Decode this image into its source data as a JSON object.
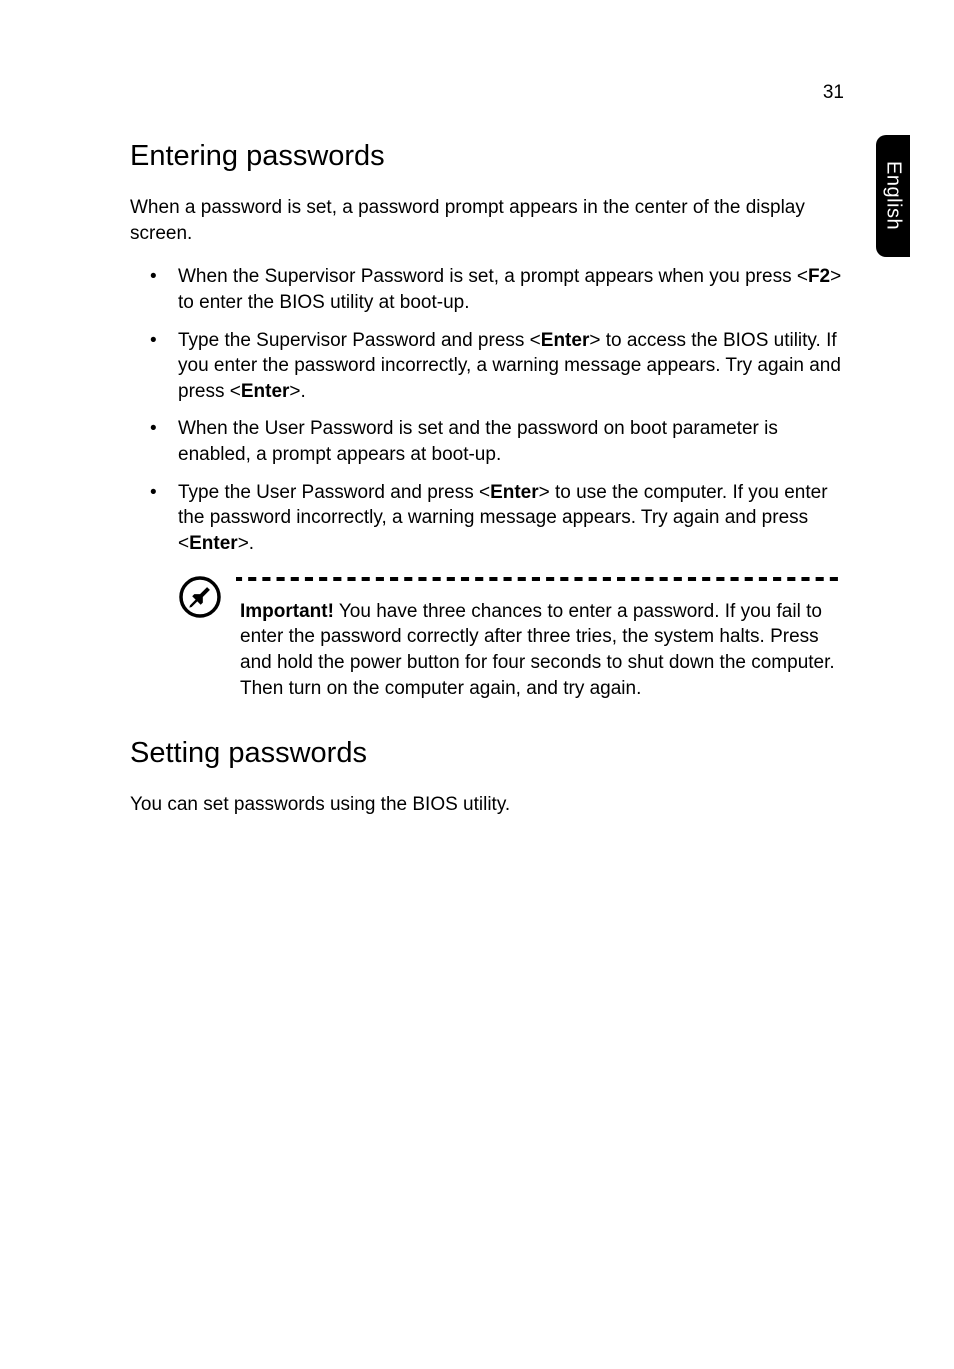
{
  "page_number": "31",
  "side_tab_label": "English",
  "section1": {
    "heading": "Entering passwords",
    "intro": "When a password is set, a password prompt appears in the center of the display screen.",
    "bullets": [
      {
        "pre": "When the Supervisor Password is set, a prompt appears when you press <",
        "key1": "F2",
        "post1": "> to enter the BIOS utility at boot-up."
      },
      {
        "pre": "Type the Supervisor Password and press <",
        "key1": "Enter",
        "mid1": "> to access the BIOS utility. If you enter the password incorrectly, a warning message appears. Try again and press <",
        "key2": "Enter",
        "post2": ">."
      },
      {
        "pre": "When the User Password is set and the password on boot parameter is enabled, a prompt appears at boot-up."
      },
      {
        "pre": "Type the User Password and press <",
        "key1": "Enter",
        "mid1": "> to use the computer. If you enter the password incorrectly, a warning message appears. Try again and press <",
        "key2": "Enter",
        "post2": ">."
      }
    ],
    "important_label": "Important!",
    "important_body": " You have three chances to enter a password. If you fail to enter the password correctly after three tries, the system halts. Press and hold the power button for four seconds to shut down the computer. Then turn on the computer again, and try again."
  },
  "section2": {
    "heading": "Setting passwords",
    "intro": "You can set passwords using the BIOS utility."
  }
}
